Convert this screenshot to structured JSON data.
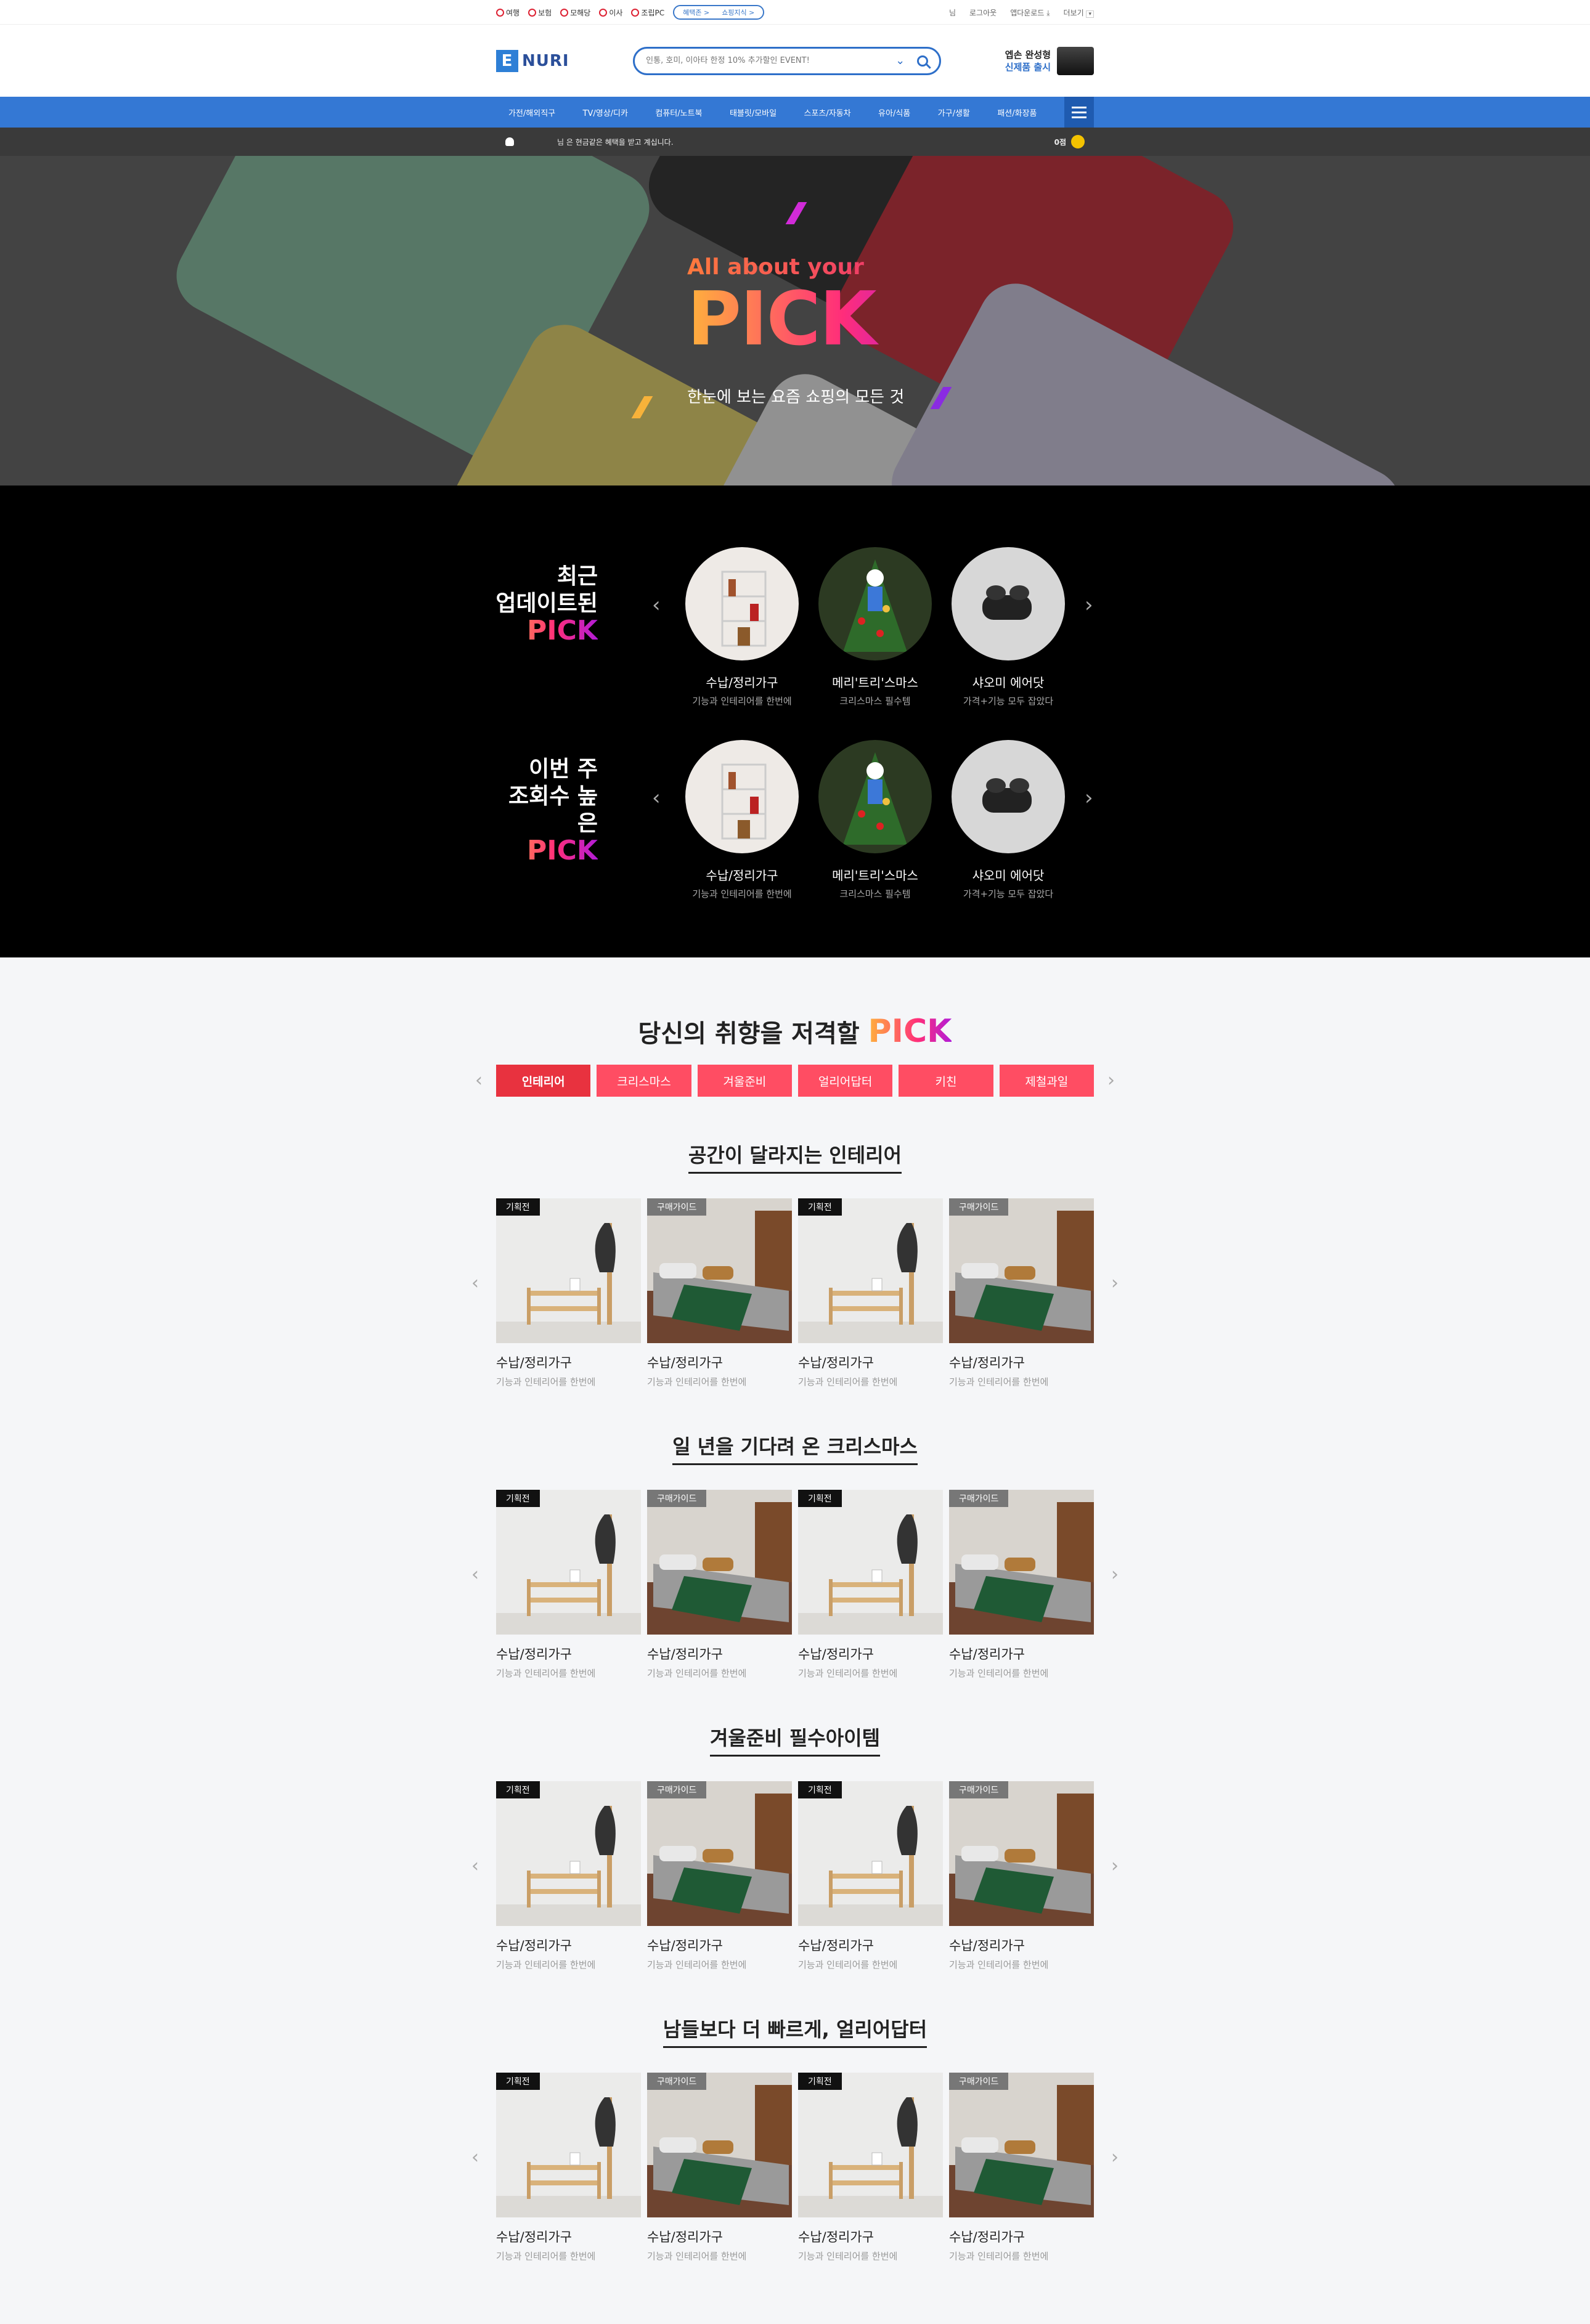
{
  "util": {
    "services": [
      "여행",
      "보험",
      "모해당",
      "이사",
      "조립PC"
    ],
    "pills": [
      "혜택존 >",
      "쇼핑지식 >"
    ],
    "right": [
      "님",
      "로그아웃",
      "앱다운로드",
      "더보기"
    ]
  },
  "header": {
    "logo": "NURI",
    "logo_mark": "E",
    "search_placeholder": "인통, 호미, 이아타 한정 10% 추가할인 EVENT!",
    "ad_line1": "엡손 완성형",
    "ad_line2": "신제품 출시"
  },
  "nav": [
    "가전/해외직구",
    "TV/영상/디카",
    "컴퓨터/노트북",
    "태블릿/모바일",
    "스포츠/자동차",
    "유아/식품",
    "가구/생활",
    "패션/화장품"
  ],
  "member": {
    "name": "님",
    "message": "은 현금같은 혜택을 받고 계십니다.",
    "points": "0점"
  },
  "hero": {
    "sub": "All about your",
    "title": "PICK",
    "desc": "한눈에 보는 요즘 쇼핑의 모든 것"
  },
  "dark": {
    "rows": [
      {
        "line1": "최근",
        "line2": "업데이트된",
        "pick": "PICK",
        "items": [
          {
            "name": "수납/정리가구",
            "desc": "기능과 인테리어를 한번에"
          },
          {
            "name": "메리'트리'스마스",
            "desc": "크리스마스 필수템"
          },
          {
            "name": "샤오미 에어닷",
            "desc": "가격+기능 모두 잡았다"
          }
        ]
      },
      {
        "line1": "이번 주",
        "line2": "조회수 높은",
        "pick": "PICK",
        "items": [
          {
            "name": "수납/정리가구",
            "desc": "기능과 인테리어를 한번에"
          },
          {
            "name": "메리'트리'스마스",
            "desc": "크리스마스 필수템"
          },
          {
            "name": "샤오미 에어닷",
            "desc": "가격+기능 모두 잡았다"
          }
        ]
      }
    ]
  },
  "light": {
    "title": "당신의 취향을 저격할",
    "pick": "PICK",
    "tabs": [
      "인테리어",
      "크리스마스",
      "겨울준비",
      "얼리어답터",
      "키친",
      "제철과일"
    ],
    "sections": [
      {
        "title": "공간이 달라지는 인테리어"
      },
      {
        "title": "일 년을 기다려 온 크리스마스"
      },
      {
        "title": "겨울준비 필수아이템"
      },
      {
        "title": "남들보다 더 빠르게, 얼리어답터"
      }
    ],
    "cards": [
      {
        "badge": "기획전",
        "name": "수납/정리가구",
        "desc": "기능과 인테리어를 한번에"
      },
      {
        "badge": "구매가이드",
        "name": "수납/정리가구",
        "desc": "기능과 인테리어를 한번에"
      },
      {
        "badge": "기획전",
        "name": "수납/정리가구",
        "desc": "기능과 인테리어를 한번에"
      },
      {
        "badge": "구매가이드",
        "name": "수납/정리가구",
        "desc": "기능과 인테리어를 한번에"
      }
    ]
  },
  "colors": {
    "brand": "#3478d4",
    "tab": "#ff4d63",
    "dark": "#000000"
  }
}
